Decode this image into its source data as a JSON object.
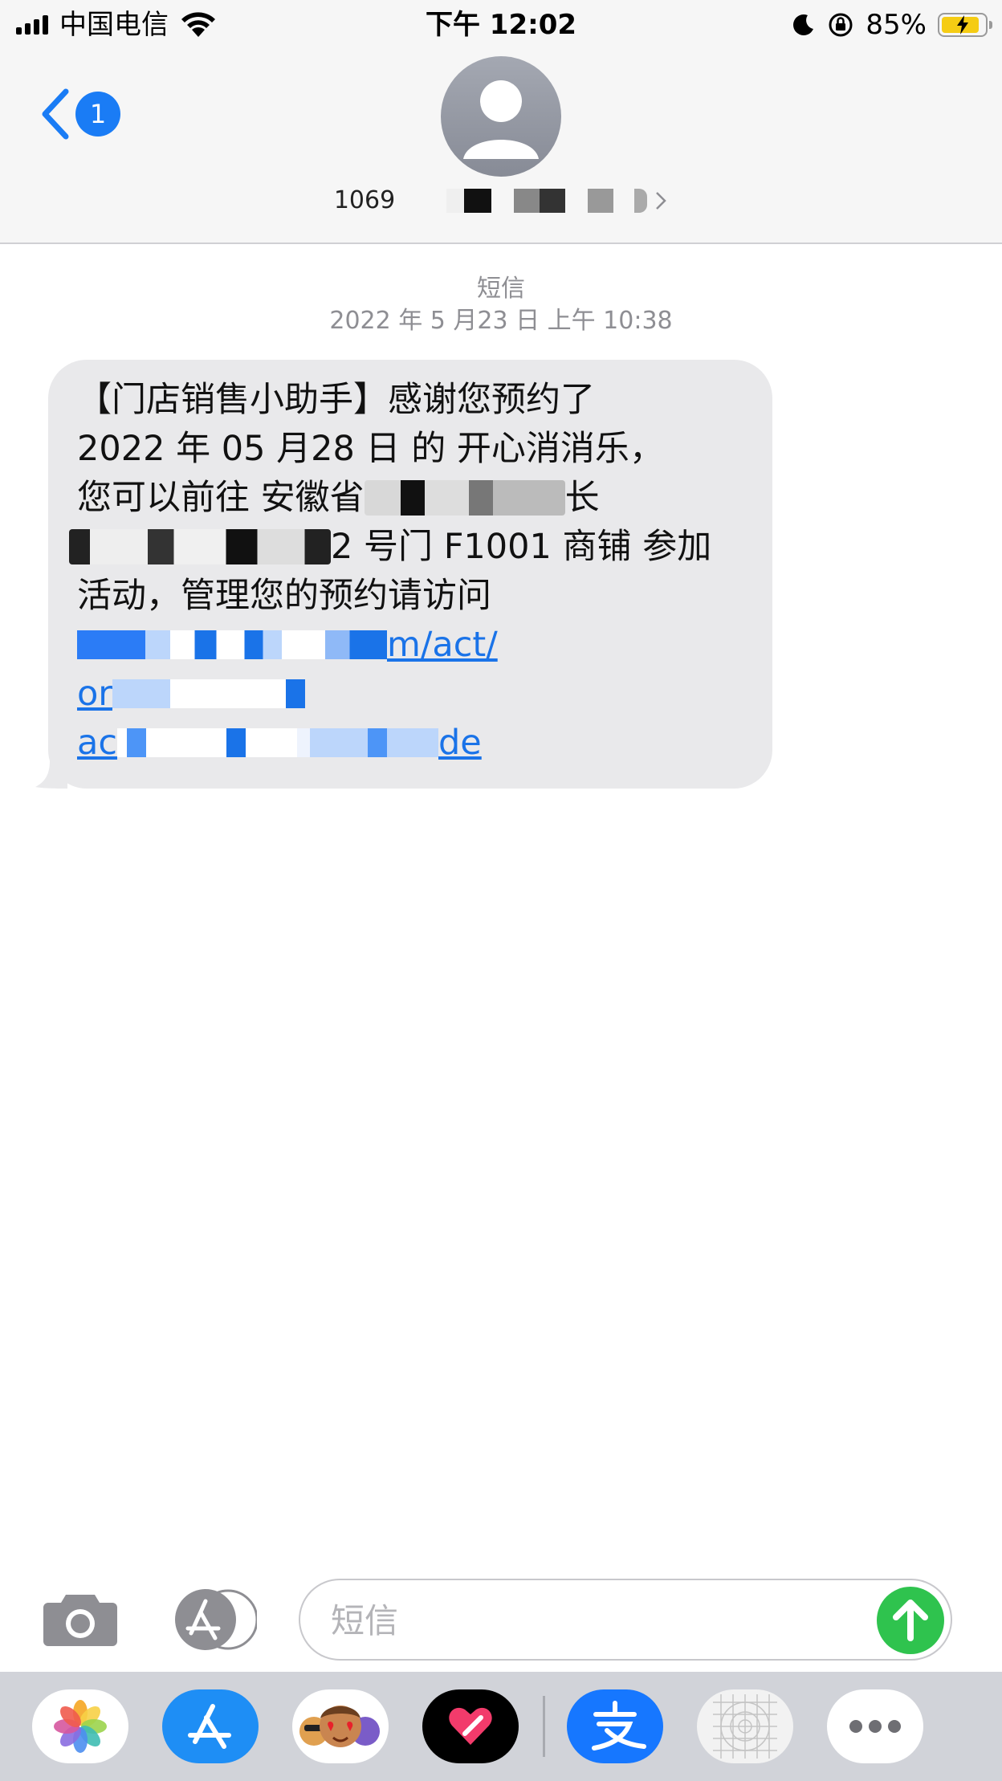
{
  "status_bar": {
    "carrier": "中国电信",
    "time": "下午 12:02",
    "battery_percent": "85%",
    "battery_level": 0.85,
    "icons": [
      "signal-icon",
      "wifi-icon",
      "moon-icon",
      "rotation-lock-icon",
      "battery-charging-icon"
    ]
  },
  "header": {
    "back_badge": "1",
    "contact_visible": "1069"
  },
  "conversation": {
    "kind": "短信",
    "date": "2022 年 5 月23 日 上午 10:38"
  },
  "message": {
    "line1": "【门店销售小助手】感谢您预约了",
    "line2": "2022 年 05 月28 日 的 开心消消乐，",
    "line3_a": "您可以前往 安徽省",
    "line3_b": "长",
    "line4": "2 号门 F1001 商铺 参加",
    "line5": "活动，管理您的预约请访问",
    "link1_tail": "m/act/",
    "link2_head": "or",
    "link3_head": "ac",
    "link3_tail": "de"
  },
  "input": {
    "placeholder": "短信"
  },
  "drawer": {
    "apps": [
      "photos-app-icon",
      "app-store-app-icon",
      "memoji-app-icon",
      "digital-touch-app-icon",
      "alipay-app-icon",
      "web-app-icon",
      "more-apps-icon"
    ]
  },
  "colors": {
    "accent": "#1a7cf5",
    "send": "#2fc34e",
    "bubble": "#e9e9eb",
    "link": "#1a73e8"
  }
}
